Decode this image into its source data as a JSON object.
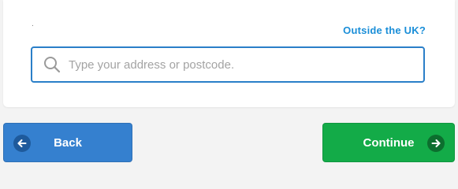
{
  "address_lookup": {
    "marker": ".",
    "outside_link_label": "Outside the UK?",
    "search": {
      "placeholder": "Type your address or postcode.",
      "value": "",
      "icon": "search-icon"
    }
  },
  "navigation": {
    "back_label": "Back",
    "back_icon": "arrow-left-icon",
    "continue_label": "Continue",
    "continue_icon": "arrow-right-icon"
  },
  "colors": {
    "link": "#1a8ed8",
    "input_border": "#2a7fc8",
    "back_button": "#3580cf",
    "continue_button": "#13ab48"
  }
}
